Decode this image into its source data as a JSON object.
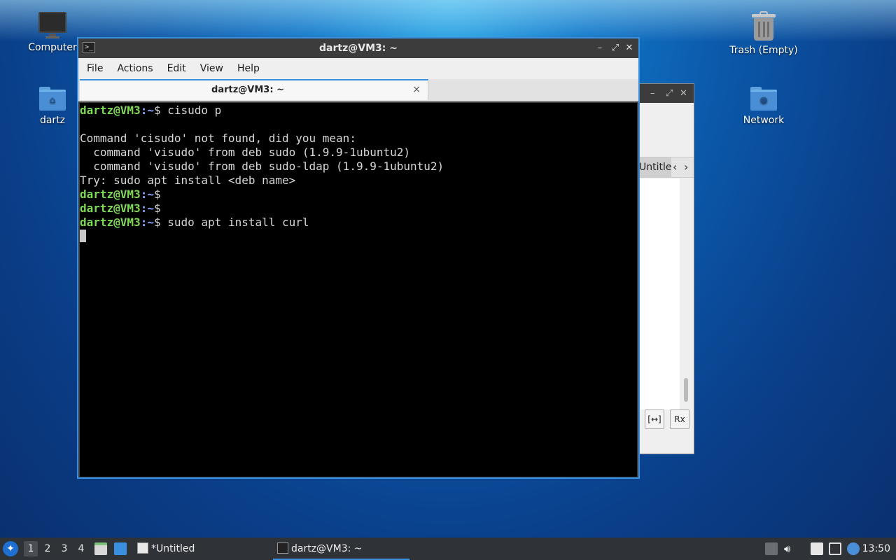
{
  "desktop": {
    "icons": [
      {
        "label": "Computer",
        "icon": "computer-icon"
      },
      {
        "label": "dartz",
        "icon": "home-folder-icon"
      },
      {
        "label": "Trash (Empty)",
        "icon": "trash-icon"
      },
      {
        "label": "Network",
        "icon": "network-folder-icon"
      }
    ]
  },
  "back_window": {
    "tab_label": "Untitled",
    "prev_arrow": "‹",
    "next_arrow": "›",
    "btn1": "[↔]",
    "btn2": "Rx"
  },
  "terminal": {
    "title": "dartz@VM3: ~",
    "menu": [
      "File",
      "Actions",
      "Edit",
      "View",
      "Help"
    ],
    "tab_title": "dartz@VM3: ~",
    "tab_close": "×",
    "win_buttons": [
      "–",
      "⤢",
      "✕"
    ],
    "prompt_user": "dartz@VM3",
    "prompt_path": ":~",
    "prompt_symbol": "$",
    "lines": [
      {
        "kind": "prompt",
        "cmd": " cisudo p"
      },
      {
        "kind": "text",
        "text": ""
      },
      {
        "kind": "text",
        "text": "Command 'cisudo' not found, did you mean:"
      },
      {
        "kind": "text",
        "text": "  command 'visudo' from deb sudo (1.9.9-1ubuntu2)"
      },
      {
        "kind": "text",
        "text": "  command 'visudo' from deb sudo-ldap (1.9.9-1ubuntu2)"
      },
      {
        "kind": "text",
        "text": "Try: sudo apt install <deb name>"
      },
      {
        "kind": "prompt",
        "cmd": ""
      },
      {
        "kind": "prompt",
        "cmd": ""
      },
      {
        "kind": "prompt",
        "cmd": " sudo apt install curl"
      },
      {
        "kind": "cursor"
      }
    ]
  },
  "taskbar": {
    "workspaces": [
      "1",
      "2",
      "3",
      "4"
    ],
    "active_workspace": "1",
    "tasks": [
      {
        "label": "*Untitled",
        "icon": "text-editor-icon",
        "active": false
      },
      {
        "label": "dartz@VM3: ~",
        "icon": "terminal-icon",
        "active": true
      }
    ],
    "clock": "13:50"
  },
  "colors": {
    "accent": "#3a8fe0",
    "prompt_user": "#7ed957",
    "prompt_path": "#8aa8ff"
  }
}
